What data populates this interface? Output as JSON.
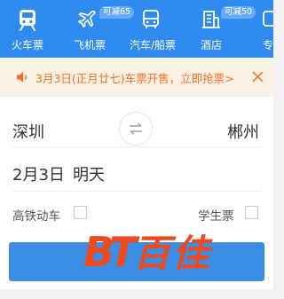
{
  "top_nav": {
    "items": [
      {
        "label": "火车票",
        "icon": "train-icon",
        "active": true
      },
      {
        "label": "飞机票",
        "icon": "airplane-icon",
        "badge": "可减65"
      },
      {
        "label": "汽车/船票",
        "icon": "bus-icon"
      },
      {
        "label": "酒店",
        "icon": "hotel-icon",
        "badge": "可减50"
      },
      {
        "label": "专",
        "icon": "more-icon"
      }
    ]
  },
  "notice": {
    "icon": "speaker-icon",
    "text": "3月3日(正月廿七)车票开售，立即抢票>",
    "close_icon": "close-icon"
  },
  "search": {
    "from_city": "深圳",
    "to_city": "郴州",
    "swap_icon": "swap-arrows-icon",
    "date": "2月3日",
    "date_desc": "明天",
    "option_highspeed": "高铁动车",
    "option_student": "学生票"
  },
  "watermark": {
    "left": "BT",
    "right": "百佳"
  },
  "colors": {
    "nav_bg": "#2f8bf0",
    "notice_bg": "#fbf1e4",
    "notice_text": "#f27022",
    "search_button": "#3a8ee6",
    "watermark": "#ef4a1e"
  }
}
